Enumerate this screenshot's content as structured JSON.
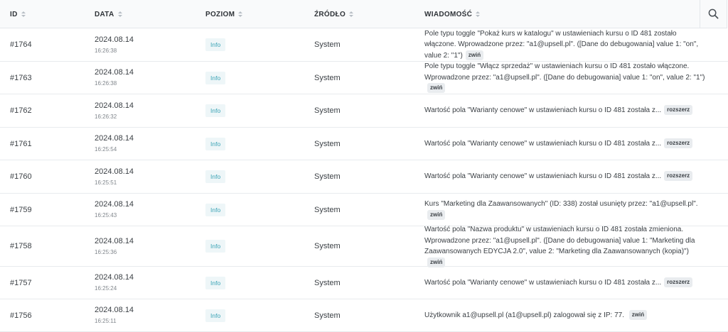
{
  "columns": {
    "id": "ID",
    "date": "DATA",
    "level": "POZIOM",
    "source": "ŹRÓDŁO",
    "message": "WIADOMOŚĆ"
  },
  "rows": [
    {
      "id": "#1764",
      "date": "2024.08.14",
      "time": "16:26:38",
      "level": "Info",
      "source": "System",
      "message": "Pole typu toggle \"Pokaż kurs w katalogu\" w ustawieniach kursu o ID 481 zostało włączone. Wprowadzone przez: \"a1@upsell.pl\". ([Dane do debugowania] value 1: \"on\", value 2: \"1\")",
      "toggle": "zwiń"
    },
    {
      "id": "#1763",
      "date": "2024.08.14",
      "time": "16:26:38",
      "level": "Info",
      "source": "System",
      "message": "Pole typu toggle \"Włącz sprzedaż\" w ustawieniach kursu o ID 481 zostało włączone. Wprowadzone przez: \"a1@upsell.pl\". ([Dane do debugowania] value 1: \"on\", value 2: \"1\")",
      "toggle": "zwiń"
    },
    {
      "id": "#1762",
      "date": "2024.08.14",
      "time": "16:26:32",
      "level": "Info",
      "source": "System",
      "message": "Wartość pola \"Warianty cenowe\" w ustawieniach kursu o ID 481 została z...",
      "toggle": "rozszerz"
    },
    {
      "id": "#1761",
      "date": "2024.08.14",
      "time": "16:25:54",
      "level": "Info",
      "source": "System",
      "message": "Wartość pola \"Warianty cenowe\" w ustawieniach kursu o ID 481 została z...",
      "toggle": "rozszerz"
    },
    {
      "id": "#1760",
      "date": "2024.08.14",
      "time": "16:25:51",
      "level": "Info",
      "source": "System",
      "message": "Wartość pola \"Warianty cenowe\" w ustawieniach kursu o ID 481 została z...",
      "toggle": "rozszerz"
    },
    {
      "id": "#1759",
      "date": "2024.08.14",
      "time": "16:25:43",
      "level": "Info",
      "source": "System",
      "message": "Kurs \"Marketing dla Zaawansowanych\" (ID: 338) został usunięty przez: \"a1@upsell.pl\".",
      "toggle": "zwiń"
    },
    {
      "id": "#1758",
      "date": "2024.08.14",
      "time": "16:25:36",
      "level": "Info",
      "source": "System",
      "message": "Wartość pola \"Nazwa produktu\" w ustawieniach kursu o ID 481 została zmieniona. Wprowadzone przez: \"a1@upsell.pl\". ([Dane do debugowania] value 1: \"Marketing dla Zaawansowanych EDYCJA 2.0\", value 2: \"Marketing dla Zaawansowanych (kopia)\")",
      "toggle": "zwiń"
    },
    {
      "id": "#1757",
      "date": "2024.08.14",
      "time": "16:25:24",
      "level": "Info",
      "source": "System",
      "message": "Wartość pola \"Warianty cenowe\" w ustawieniach kursu o ID 481 została z...",
      "toggle": "rozszerz"
    },
    {
      "id": "#1756",
      "date": "2024.08.14",
      "time": "16:25:11",
      "level": "Info",
      "source": "System",
      "message": "Użytkownik a1@upsell.pl (a1@upsell.pl) zalogował się z IP: 77.                    ",
      "toggle": "zwiń"
    }
  ],
  "icons": {
    "search": "search-icon",
    "sort": "sort-icon"
  }
}
